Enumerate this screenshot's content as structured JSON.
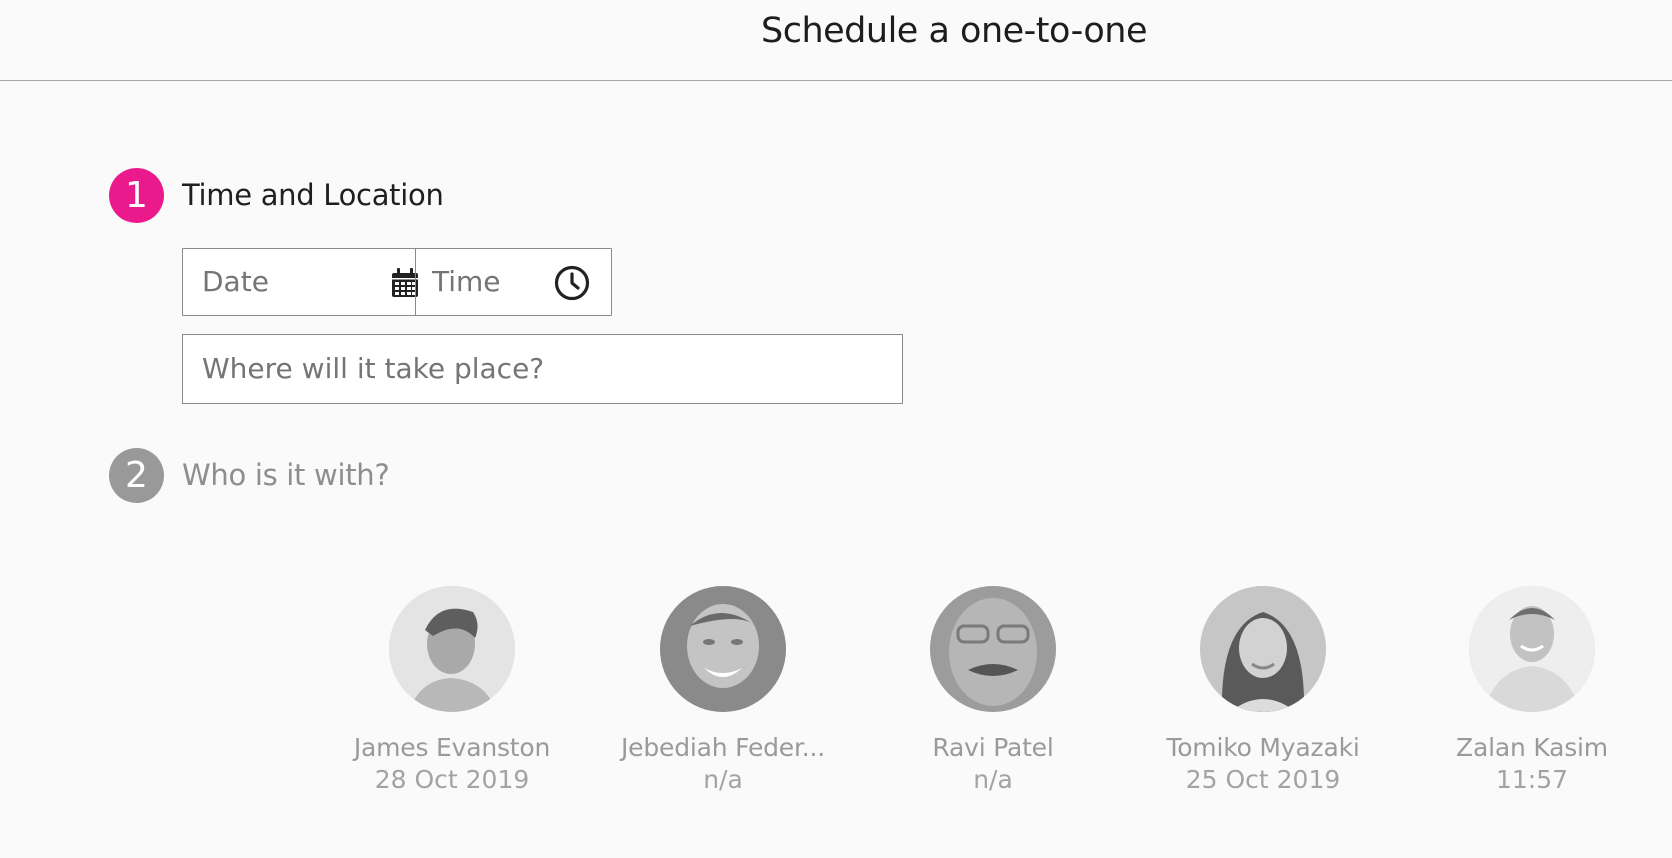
{
  "header": {
    "title": "Schedule a one-to-one"
  },
  "steps": [
    {
      "number": "1",
      "title": "Time and Location",
      "color": "#ea1a8c"
    },
    {
      "number": "2",
      "title": "Who is it with?",
      "color": "#999999"
    }
  ],
  "form": {
    "date_placeholder": "Date",
    "time_placeholder": "Time",
    "location_placeholder": "Where will it take place?",
    "date_icon": "calendar-icon",
    "time_icon": "clock-icon"
  },
  "people": [
    {
      "name": "James Evanston",
      "meta": "28 Oct 2019"
    },
    {
      "name": "Jebediah Feder...",
      "meta": "n/a"
    },
    {
      "name": "Ravi Patel",
      "meta": "n/a"
    },
    {
      "name": "Tomiko Myazaki",
      "meta": "25 Oct 2019"
    },
    {
      "name": "Zalan Kasim",
      "meta": "11:57"
    }
  ]
}
